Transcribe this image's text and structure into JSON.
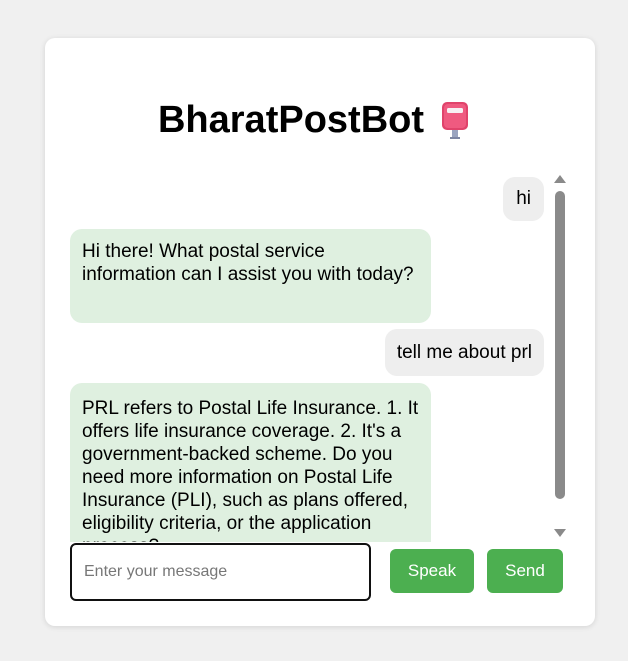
{
  "app": {
    "title": "BharatPostBot",
    "title_icon": "postbox-icon"
  },
  "messages": [
    {
      "role": "user",
      "text": "hi"
    },
    {
      "role": "bot",
      "text": "Hi there! What postal service information can I assist you with today?"
    },
    {
      "role": "user",
      "text": "tell me about prl"
    },
    {
      "role": "bot",
      "text": "PRL refers to Postal Life Insurance. 1. It offers life insurance coverage. 2. It's a government-backed scheme. Do you need more information on Postal Life Insurance (PLI), such as plans offered, eligibility criteria, or the application process?"
    }
  ],
  "composer": {
    "placeholder": "Enter your message",
    "value": "",
    "speak_label": "Speak",
    "send_label": "Send"
  },
  "colors": {
    "button": "#4caf50",
    "bot_bubble": "#dff0e0",
    "user_bubble": "#eeeeee"
  }
}
